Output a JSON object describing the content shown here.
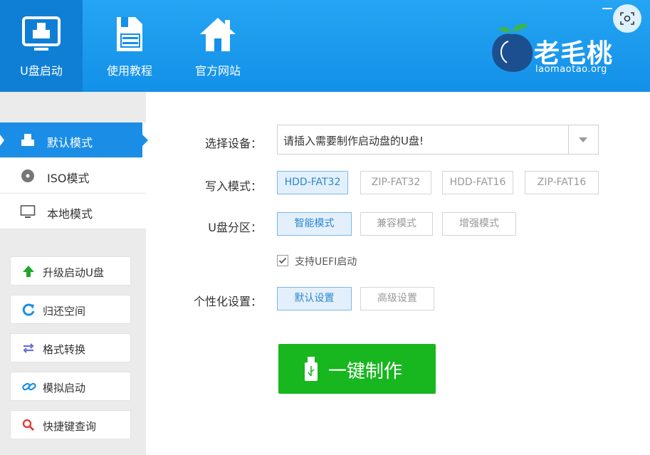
{
  "header": {
    "nav": [
      {
        "label": "U盘启动",
        "icon": "monitor-icon",
        "active": true
      },
      {
        "label": "使用教程",
        "icon": "document-icon",
        "active": false
      },
      {
        "label": "官方网站",
        "icon": "home-icon",
        "active": false
      }
    ],
    "brand": {
      "name": "老毛桃",
      "site": "laomaotao.org"
    }
  },
  "sidebar": {
    "modes": [
      {
        "label": "默认模式",
        "icon": "usb-drive-icon",
        "active": true
      },
      {
        "label": "ISO模式",
        "icon": "disc-icon",
        "active": false
      },
      {
        "label": "本地模式",
        "icon": "monitor-icon",
        "active": false
      }
    ],
    "tools": [
      {
        "label": "升级启动U盘",
        "icon": "arrow-up-icon",
        "color": "#1fa72b"
      },
      {
        "label": "归还空间",
        "icon": "refresh-icon",
        "color": "#1a8ee6"
      },
      {
        "label": "格式转换",
        "icon": "swap-icon",
        "color": "#6b6fd1"
      },
      {
        "label": "模拟启动",
        "icon": "link-icon",
        "color": "#1a8ee6"
      },
      {
        "label": "快捷键查询",
        "icon": "search-icon",
        "color": "#e23c3c"
      }
    ]
  },
  "main": {
    "device": {
      "label": "选择设备：",
      "value": "请插入需要制作启动盘的U盘!"
    },
    "write_mode": {
      "label": "写入模式：",
      "options": [
        "HDD-FAT32",
        "ZIP-FAT32",
        "HDD-FAT16",
        "ZIP-FAT16"
      ],
      "selected": "HDD-FAT32"
    },
    "partition": {
      "label": "U盘分区：",
      "options": [
        "智能模式",
        "兼容模式",
        "增强模式"
      ],
      "selected": "智能模式"
    },
    "uefi": {
      "label": "支持UEFI启动",
      "checked": true
    },
    "personal": {
      "label": "个性化设置：",
      "options": [
        "默认设置",
        "高级设置"
      ],
      "selected": "默认设置"
    },
    "make_button": "一键制作"
  },
  "colors": {
    "header_blue": "#1a9aef",
    "accent_blue": "#1a8ee6",
    "make_green": "#18b61f"
  }
}
